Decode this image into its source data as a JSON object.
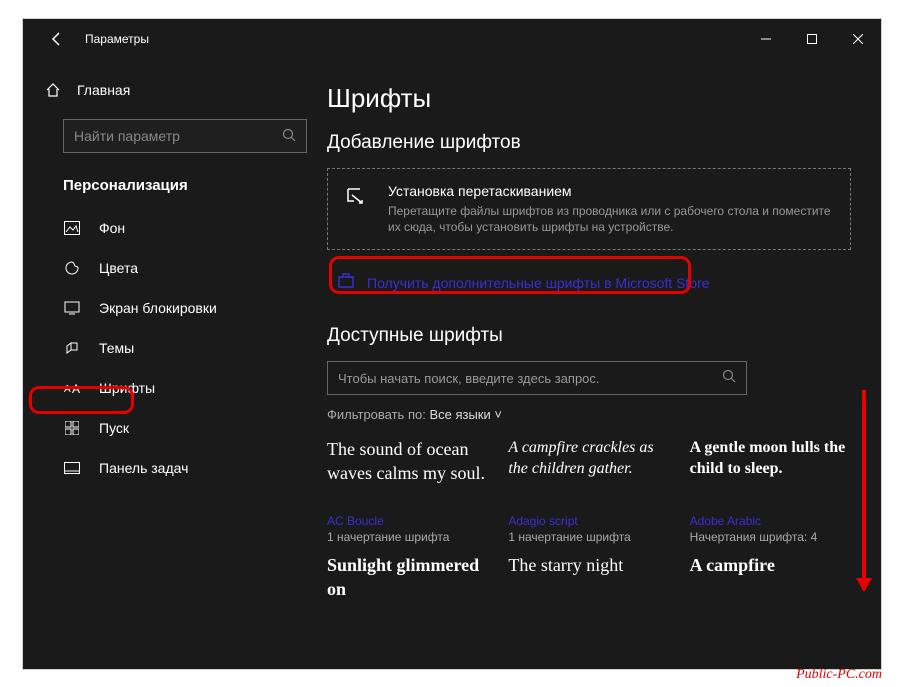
{
  "titlebar": {
    "title": "Параметры"
  },
  "sidebar": {
    "home": "Главная",
    "search_placeholder": "Найти параметр",
    "category": "Персонализация",
    "items": [
      {
        "label": "Фон"
      },
      {
        "label": "Цвета"
      },
      {
        "label": "Экран блокировки"
      },
      {
        "label": "Темы"
      },
      {
        "label": "Шрифты"
      },
      {
        "label": "Пуск"
      },
      {
        "label": "Панель задач"
      }
    ]
  },
  "content": {
    "page_title": "Шрифты",
    "add_section": "Добавление шрифтов",
    "drop_title": "Установка перетаскиванием",
    "drop_desc": "Перетащите файлы шрифтов из проводника или с рабочего стола и поместите их сюда, чтобы установить шрифты на устройстве.",
    "store_link": "Получить дополнительные шрифты в Microsoft Store",
    "available_section": "Доступные шрифты",
    "font_search_placeholder": "Чтобы начать поиск, введите здесь запрос.",
    "filter_label": "Фильтровать по:",
    "filter_value": "Все языки"
  },
  "fonts": [
    {
      "preview": "The sound of ocean waves calms my soul.",
      "name": "AC Boucle",
      "count": "1 начертание шрифта",
      "cls": "boucle"
    },
    {
      "preview": "A campfire crackles as the children gather.",
      "name": "Adagio script",
      "count": "1 начертание шрифта",
      "cls": "script"
    },
    {
      "preview": "A gentle moon lulls the child to sleep.",
      "name": "Adobe Arabic",
      "count": "Начертания шрифта: 4",
      "cls": "arabic"
    },
    {
      "preview": "Sunlight glimmered on",
      "name": "",
      "count": "",
      "cls": "sunlight"
    },
    {
      "preview": "The starry night",
      "name": "",
      "count": "",
      "cls": "starry"
    },
    {
      "preview": "A campfire",
      "name": "",
      "count": "",
      "cls": "camp2"
    }
  ],
  "watermark": "Public-PC.com"
}
